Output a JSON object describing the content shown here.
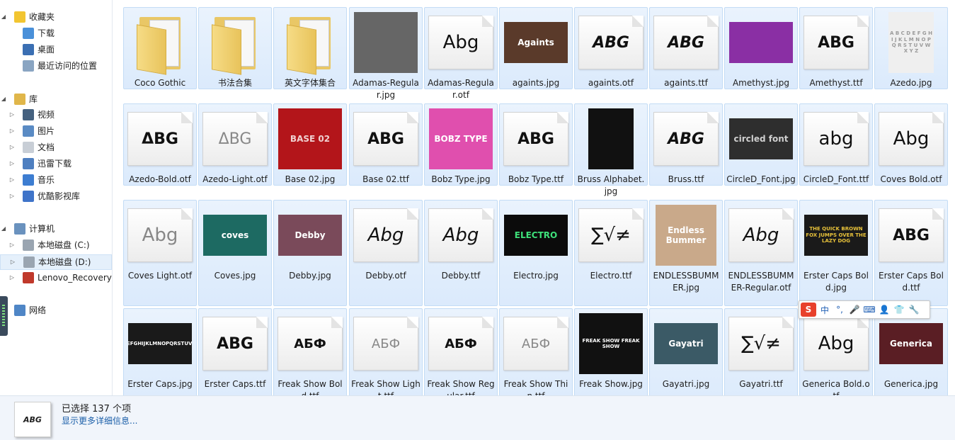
{
  "nav": {
    "favorites": {
      "label": "收藏夹",
      "items": [
        "下载",
        "桌面",
        "最近访问的位置"
      ]
    },
    "libraries": {
      "label": "库",
      "items": [
        "视频",
        "图片",
        "文档",
        "迅雷下载",
        "音乐",
        "优酷影视库"
      ]
    },
    "computer": {
      "label": "计算机",
      "items": [
        "本地磁盘 (C:)",
        "本地磁盘 (D:)",
        "Lenovo_Recovery ("
      ]
    },
    "network": {
      "label": "网络"
    }
  },
  "files": [
    {
      "name": "Coco Gothic",
      "kind": "folder"
    },
    {
      "name": "书法合集",
      "kind": "folder"
    },
    {
      "name": "英文字体集合",
      "kind": "folder"
    },
    {
      "name": "Adamas-Regular.jpg",
      "kind": "image",
      "thumb": "",
      "bg": "#666666",
      "fg": "#ffffff"
    },
    {
      "name": "Adamas-Regular.otf",
      "kind": "font",
      "glyph": "Abg"
    },
    {
      "name": "againts.jpg",
      "kind": "image",
      "thumb": "Againts",
      "bg": "#5a3a2a",
      "fg": "#ffffff"
    },
    {
      "name": "againts.otf",
      "kind": "font",
      "glyph": "ABG"
    },
    {
      "name": "againts.ttf",
      "kind": "font",
      "glyph": "ABG"
    },
    {
      "name": "Amethyst.jpg",
      "kind": "image",
      "thumb": "",
      "bg": "#8a2fa4",
      "fg": "#ffffff"
    },
    {
      "name": "Amethyst.ttf",
      "kind": "font",
      "glyph": "ABG"
    },
    {
      "name": "Azedo.jpg",
      "kind": "image",
      "thumb": "A B C D E F G H I J K L M N O P Q R S T U V W X Y Z",
      "bg": "#efefef",
      "fg": "#9a9a9a"
    },
    {
      "name": "Azedo-Bold.otf",
      "kind": "font",
      "glyph": "ΔBG"
    },
    {
      "name": "Azedo-Light.otf",
      "kind": "font",
      "glyph": "ΔBG"
    },
    {
      "name": "Base 02.jpg",
      "kind": "image",
      "thumb": "BASE 02",
      "bg": "#b3151a",
      "fg": "#f0d0d0"
    },
    {
      "name": "Base 02.ttf",
      "kind": "font",
      "glyph": "ABG"
    },
    {
      "name": "Bobz Type.jpg",
      "kind": "image",
      "thumb": "BOBZ TYPE",
      "bg": "#e04fae",
      "fg": "#ffffff"
    },
    {
      "name": "Bobz Type.ttf",
      "kind": "font",
      "glyph": "ABG"
    },
    {
      "name": "Bruss Alphabet.jpg",
      "kind": "image",
      "thumb": "",
      "bg": "#111111",
      "fg": "#ffffff"
    },
    {
      "name": "Bruss.ttf",
      "kind": "font",
      "glyph": "ABG"
    },
    {
      "name": "CircleD_Font.jpg",
      "kind": "image",
      "thumb": "circled font",
      "bg": "#2e2e2e",
      "fg": "#cfcfcf"
    },
    {
      "name": "CircleD_Font.ttf",
      "kind": "font",
      "glyph": "abg"
    },
    {
      "name": "Coves Bold.otf",
      "kind": "font",
      "glyph": "Abg"
    },
    {
      "name": "Coves Light.otf",
      "kind": "font",
      "glyph": "Abg"
    },
    {
      "name": "Coves.jpg",
      "kind": "image",
      "thumb": "coves",
      "bg": "#1d6a62",
      "fg": "#ffffff"
    },
    {
      "name": "Debby.jpg",
      "kind": "image",
      "thumb": "Debby",
      "bg": "#7a4a5a",
      "fg": "#ffffff"
    },
    {
      "name": "Debby.otf",
      "kind": "font",
      "glyph": "Abg"
    },
    {
      "name": "Debby.ttf",
      "kind": "font",
      "glyph": "Abg"
    },
    {
      "name": "Electro.jpg",
      "kind": "image",
      "thumb": "ELECTRO",
      "bg": "#0b0b0b",
      "fg": "#3ee07a"
    },
    {
      "name": "Electro.ttf",
      "kind": "font",
      "glyph": "∑√≠"
    },
    {
      "name": "ENDLESSBUMMER.jpg",
      "kind": "image",
      "thumb": "Endless Bummer",
      "bg": "#c9a98a",
      "fg": "#ffffff"
    },
    {
      "name": "ENDLESSBUMMER-Regular.otf",
      "kind": "font",
      "glyph": "Abg"
    },
    {
      "name": "Erster Caps Bold.jpg",
      "kind": "image",
      "thumb": "THE QUICK BROWN FOX JUMPS OVER THE LAZY DOG",
      "bg": "#1a1a1a",
      "fg": "#e8c23a"
    },
    {
      "name": "Erster Caps Bold.ttf",
      "kind": "font",
      "glyph": "ABG"
    },
    {
      "name": "Erster Caps.jpg",
      "kind": "image",
      "thumb": "ABCDEFGHIJKLMNOPQRSTUVWXYZ",
      "bg": "#1a1a1a",
      "fg": "#ffffff"
    },
    {
      "name": "Erster Caps.ttf",
      "kind": "font",
      "glyph": "ABG"
    },
    {
      "name": "Freak Show Bold.ttf",
      "kind": "font",
      "glyph": "АБФ"
    },
    {
      "name": "Freak Show Light.ttf",
      "kind": "font",
      "glyph": "АБФ"
    },
    {
      "name": "Freak Show Regular.ttf",
      "kind": "font",
      "glyph": "АБФ"
    },
    {
      "name": "Freak Show Thin.ttf",
      "kind": "font",
      "glyph": "АБФ"
    },
    {
      "name": "Freak Show.jpg",
      "kind": "image",
      "thumb": "FREAK SHOW FREAK SHOW",
      "bg": "#111111",
      "fg": "#ffffff"
    },
    {
      "name": "Gayatri.jpg",
      "kind": "image",
      "thumb": "Gayatri",
      "bg": "#3b5a66",
      "fg": "#ffffff"
    },
    {
      "name": "Gayatri.ttf",
      "kind": "font",
      "glyph": "∑√≠"
    },
    {
      "name": "Generica Bold.otf",
      "kind": "font",
      "glyph": "Abg"
    },
    {
      "name": "Generica.jpg",
      "kind": "image",
      "thumb": "Generica",
      "bg": "#5a1e24",
      "fg": "#ffffff"
    }
  ],
  "ime": [
    "中",
    "°,",
    "🎤",
    "⌨",
    "👤",
    "👕",
    "🔧"
  ],
  "ime_logo": "S",
  "status": {
    "selection": "已选择 137 个项",
    "details_link": "显示更多详细信息...",
    "thumb_glyph": "ABG"
  }
}
